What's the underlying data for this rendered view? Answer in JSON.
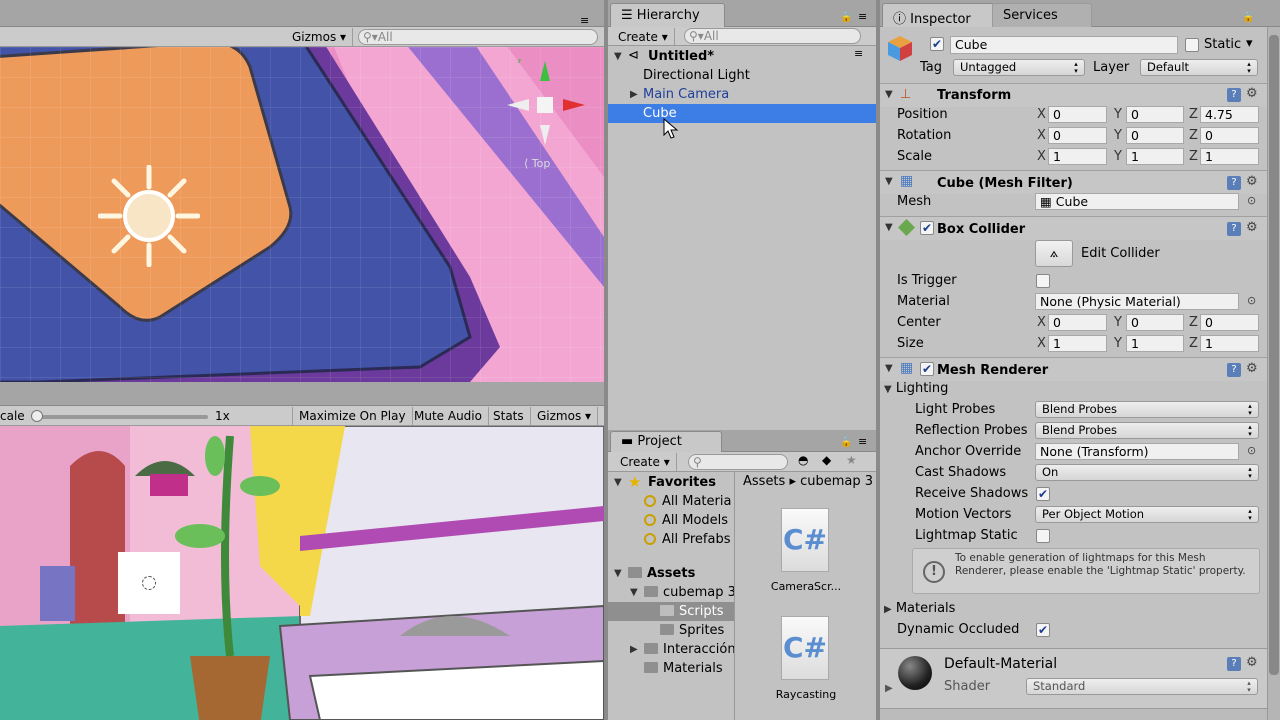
{
  "scene_view": {
    "toolbar": {
      "gizmos_label": "Gizmos",
      "search_placeholder": "All"
    },
    "persp_label": "Top"
  },
  "game_view": {
    "scale_label": "cale",
    "scale_value": "1x",
    "maximize_label": "Maximize On Play",
    "mute_label": "Mute Audio",
    "stats_label": "Stats",
    "gizmos_label": "Gizmos"
  },
  "hierarchy": {
    "tab_label": "Hierarchy",
    "create_label": "Create",
    "search_placeholder": "All",
    "scene_name": "Untitled*",
    "items": [
      {
        "label": "Directional Light"
      },
      {
        "label": "Main Camera"
      },
      {
        "label": "Cube"
      }
    ]
  },
  "project": {
    "tab_label": "Project",
    "create_label": "Create",
    "favorites_label": "Favorites",
    "favorites": [
      "All Materia",
      "All Models",
      "All Prefabs"
    ],
    "assets_label": "Assets",
    "tree": [
      "cubemap 3",
      "Scripts",
      "Sprites",
      "Interacción",
      "Materials"
    ],
    "breadcrumb": [
      "Assets",
      "cubemap 3"
    ],
    "files": [
      {
        "name": "CameraScr...",
        "icon": "csharp-script-icon",
        "glyph": "C#"
      },
      {
        "name": "Raycasting",
        "icon": "csharp-script-icon",
        "glyph": "C#"
      }
    ]
  },
  "inspector": {
    "tab_label": "Inspector",
    "services_label": "Services",
    "object_name": "Cube",
    "static_label": "Static",
    "tag_label": "Tag",
    "tag_value": "Untagged",
    "layer_label": "Layer",
    "layer_value": "Default",
    "transform": {
      "title": "Transform",
      "position_label": "Position",
      "position": [
        "0",
        "0",
        "4.75"
      ],
      "rotation_label": "Rotation",
      "rotation": [
        "0",
        "0",
        "0"
      ],
      "scale_label": "Scale",
      "scale": [
        "1",
        "1",
        "1"
      ]
    },
    "mesh_filter": {
      "title": "Cube (Mesh Filter)",
      "mesh_label": "Mesh",
      "mesh_value": "Cube"
    },
    "box_collider": {
      "title": "Box Collider",
      "edit_label": "Edit Collider",
      "is_trigger_label": "Is Trigger",
      "material_label": "Material",
      "material_value": "None (Physic Material)",
      "center_label": "Center",
      "center": [
        "0",
        "0",
        "0"
      ],
      "size_label": "Size",
      "size": [
        "1",
        "1",
        "1"
      ]
    },
    "mesh_renderer": {
      "title": "Mesh Renderer",
      "lighting_label": "Lighting",
      "light_probes_label": "Light Probes",
      "light_probes_value": "Blend Probes",
      "reflection_probes_label": "Reflection Probes",
      "reflection_probes_value": "Blend Probes",
      "anchor_label": "Anchor Override",
      "anchor_value": "None (Transform)",
      "cast_shadows_label": "Cast Shadows",
      "cast_shadows_value": "On",
      "receive_shadows_label": "Receive Shadows",
      "motion_vectors_label": "Motion Vectors",
      "motion_vectors_value": "Per Object Motion",
      "lightmap_static_label": "Lightmap Static",
      "info_text": "To enable generation of lightmaps for this Mesh Renderer, please enable the 'Lightmap Static' property.",
      "materials_label": "Materials",
      "dynamic_occluded_label": "Dynamic Occluded"
    },
    "material": {
      "name": "Default-Material",
      "shader_label": "Shader",
      "shader_value": "Standard"
    },
    "axis": {
      "x": "X",
      "y": "Y",
      "z": "Z"
    }
  },
  "colors": {
    "selection": "#3d7ee6",
    "panel": "#c2c2c2"
  }
}
